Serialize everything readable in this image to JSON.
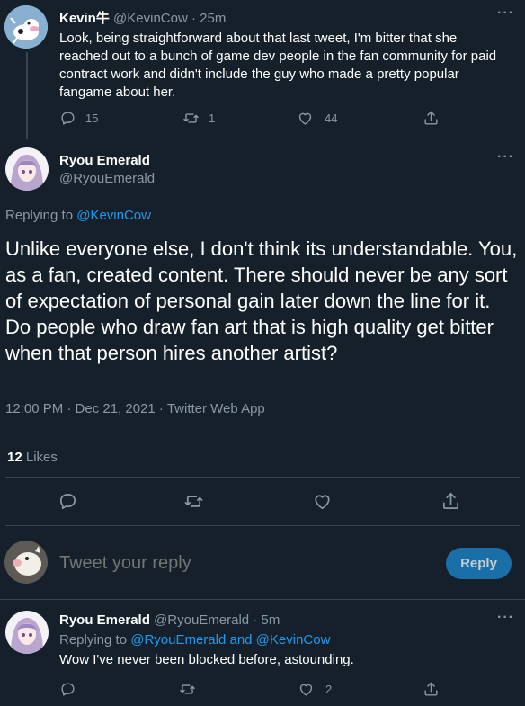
{
  "tweet1": {
    "name": "Kevin牛",
    "handle": "@KevinCow",
    "dot": "·",
    "time": "25m",
    "text": "Look, being straightforward about that last tweet, I'm bitter that she reached out to a bunch of game dev people in the fan community for paid contract work and didn't include the guy who made a pretty popular fangame about her.",
    "replies": "15",
    "retweets": "1",
    "likes": "44"
  },
  "main": {
    "name": "Ryou Emerald",
    "handle": "@RyouEmerald",
    "replying_prefix": "Replying to",
    "replying_to": "@KevinCow",
    "text": "Unlike everyone else, I don't think its understandable. You, as a fan, created content. There should never be any sort of expectation of personal gain later down the line for it.\nDo people who draw fan art that is high quality get bitter when that person hires another artist?",
    "timestamp": "12:00 PM · Dec 21, 2021 · Twitter Web App",
    "likes_count": "12",
    "likes_label": "Likes"
  },
  "composer": {
    "placeholder": "Tweet your reply",
    "button": "Reply"
  },
  "reply": {
    "name": "Ryou Emerald",
    "handle": "@RyouEmerald",
    "dot": "·",
    "time": "5m",
    "replying_prefix": "Replying to",
    "replying_to": "@RyouEmerald and @KevinCow",
    "text": "Wow I've never been blocked before, astounding.",
    "likes": "2"
  },
  "icons": {
    "more": "more-horizontal-icon",
    "reply": "reply-icon",
    "retweet": "retweet-icon",
    "like": "heart-icon",
    "share": "share-icon"
  },
  "colors": {
    "background": "#15202b",
    "link": "#1d9bf0",
    "muted": "#8899a6",
    "divider": "#38444d",
    "reply_button": "#1a6fa8"
  }
}
